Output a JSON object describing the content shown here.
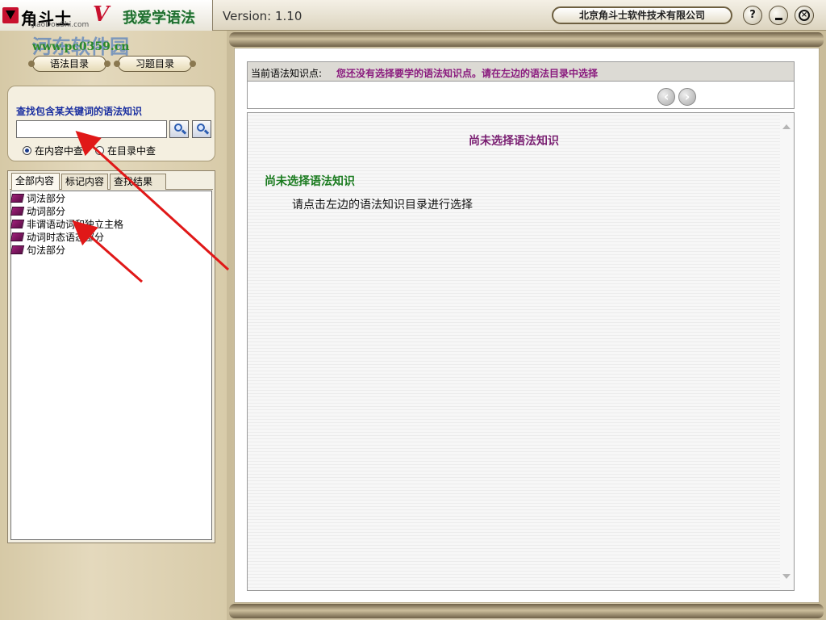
{
  "app": {
    "title": "角斗士",
    "subtitle": "我爱学语法",
    "version": "Version: 1.10",
    "company": "北京角斗士软件技术有限公司",
    "watermark_site": "河东软件园",
    "watermark_url": "www.pc0359.cn",
    "watermark_sub": "JiaoDouShi.com",
    "window_controls": {
      "help": "?"
    }
  },
  "left": {
    "nav_buttons": [
      "语法目录",
      "习题目录"
    ],
    "search": {
      "title": "查找包含某关键词的语法知识",
      "value": "",
      "radios": [
        {
          "label": "在内容中查",
          "checked": true
        },
        {
          "label": "在目录中查",
          "checked": false
        }
      ]
    },
    "tabs": [
      "全部内容",
      "标记内容",
      "查找结果"
    ],
    "tree_items": [
      {
        "label": "词法部分",
        "icon": "book-icon"
      },
      {
        "label": "动词部分",
        "icon": "book-icon"
      },
      {
        "label": "非谓语动词和独立主格",
        "icon": "book-icon"
      },
      {
        "label": "动词时态语态部分",
        "icon": "book-icon"
      },
      {
        "label": "句法部分",
        "icon": "book-icon"
      }
    ]
  },
  "main": {
    "info_label": "当前语法知识点:",
    "info_text": "您还没有选择要学的语法知识点。请在左边的语法目录中选择",
    "heading": "尚未选择语法知识",
    "subheading": "尚未选择语法知识",
    "body": "请点击左边的语法知识目录进行选择"
  },
  "colors": {
    "accent_purple": "#8a1b7e",
    "accent_green": "#1a7b1f",
    "link_blue": "#1a2fa0",
    "annotation_red": "#e01818"
  }
}
